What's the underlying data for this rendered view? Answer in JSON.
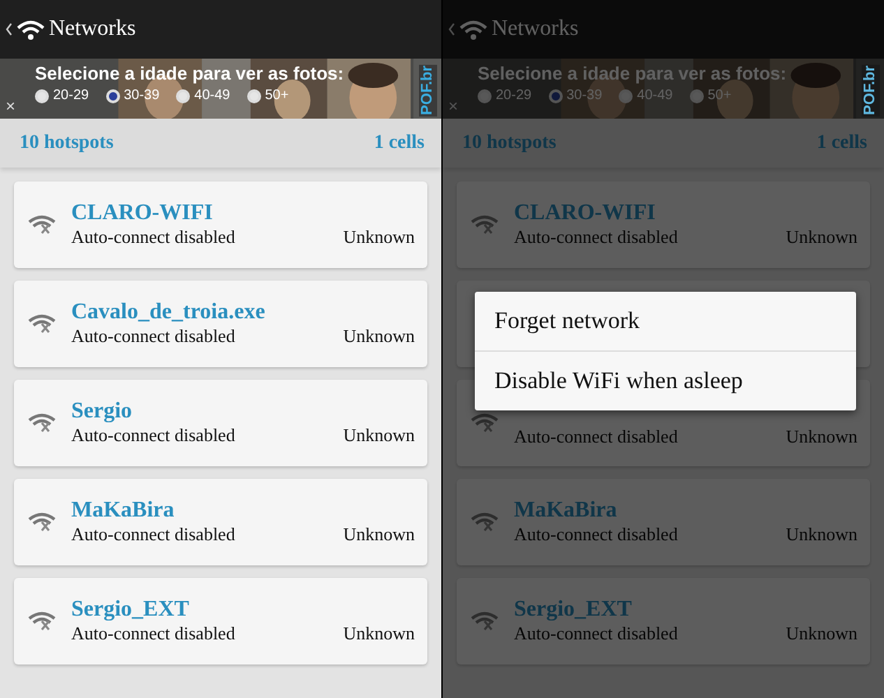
{
  "panes": [
    {
      "title": "Networks",
      "dimmed": false,
      "ad": {
        "heading": "Selecione a idade para ver as fotos:",
        "brand": "POF.br",
        "close": "×",
        "options": [
          {
            "label": "20-29",
            "selected": false
          },
          {
            "label": "30-39",
            "selected": true
          },
          {
            "label": "40-49",
            "selected": false
          },
          {
            "label": "50+",
            "selected": false
          }
        ]
      },
      "hotspots": "10 hotspots",
      "cells": "1 cells",
      "networks": [
        {
          "kind": "network",
          "name": "CLARO-WIFI",
          "status": "Auto-connect disabled",
          "signal": "Unknown"
        },
        {
          "kind": "network",
          "name": "Cavalo_de_troia.exe",
          "status": "Auto-connect disabled",
          "signal": "Unknown"
        },
        {
          "kind": "network",
          "name": "Sergio",
          "status": "Auto-connect disabled",
          "signal": "Unknown"
        },
        {
          "kind": "network",
          "name": "MaKaBira",
          "status": "Auto-connect disabled",
          "signal": "Unknown"
        },
        {
          "kind": "network",
          "name": "Sergio_EXT",
          "status": "Auto-connect disabled",
          "signal": "Unknown"
        }
      ]
    },
    {
      "title": "Networks",
      "dimmed": true,
      "ad": {
        "heading": "Selecione a idade para ver as fotos:",
        "brand": "POF.br",
        "close": "×",
        "options": [
          {
            "label": "20-29",
            "selected": false
          },
          {
            "label": "30-39",
            "selected": true
          },
          {
            "label": "40-49",
            "selected": false
          },
          {
            "label": "50+",
            "selected": false
          }
        ]
      },
      "hotspots": "10 hotspots",
      "cells": "1 cells",
      "networks": [
        {
          "kind": "network",
          "name": "CLARO-WIFI",
          "status": "Auto-connect disabled",
          "signal": "Unknown"
        },
        {
          "kind": "covered"
        },
        {
          "kind": "network",
          "status": "Auto-connect disabled",
          "signal": "Unknown"
        },
        {
          "kind": "network",
          "name": "MaKaBira",
          "status": "Auto-connect disabled",
          "signal": "Unknown"
        },
        {
          "kind": "network",
          "name": "Sergio_EXT",
          "status": "Auto-connect disabled",
          "signal": "Unknown"
        }
      ],
      "menu": [
        "Forget network",
        "Disable WiFi when asleep"
      ]
    }
  ]
}
